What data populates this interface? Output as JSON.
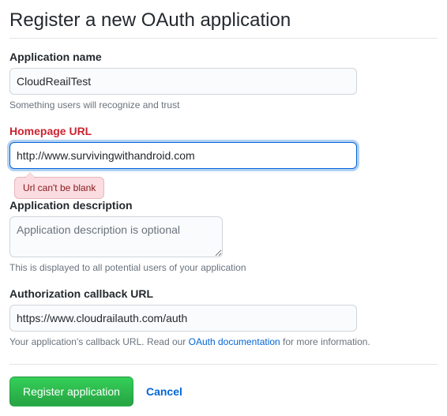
{
  "page": {
    "title": "Register a new OAuth application"
  },
  "fields": {
    "appName": {
      "label": "Application name",
      "value": "CloudReailTest",
      "note": "Something users will recognize and trust"
    },
    "homepage": {
      "label": "Homepage URL",
      "value": "http://www.survivingwithandroid.com",
      "error": "Url can't be blank"
    },
    "description": {
      "label": "Application description",
      "placeholder": "Application description is optional",
      "value": "",
      "note": "This is displayed to all potential users of your application"
    },
    "callback": {
      "label": "Authorization callback URL",
      "value": "https://www.cloudrailauth.com/auth",
      "notePrefix": "Your application's callback URL. Read our ",
      "noteLink": "OAuth documentation",
      "noteSuffix": " for more information."
    }
  },
  "actions": {
    "submit": "Register application",
    "cancel": "Cancel"
  }
}
